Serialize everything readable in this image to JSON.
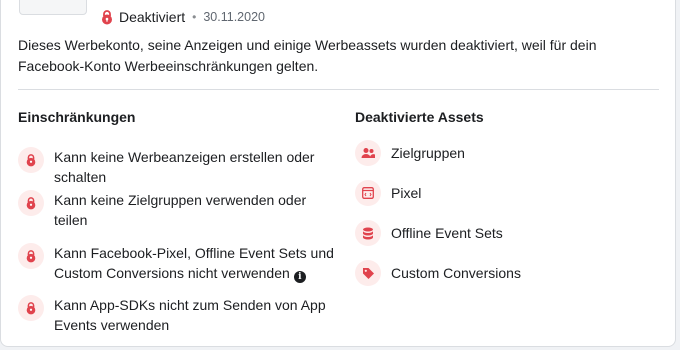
{
  "colors": {
    "accent": "#e0434d",
    "badge_bg": "#fdeceb"
  },
  "status": {
    "label": "Deaktiviert",
    "date": "30.11.2020",
    "icon": "lock-icon"
  },
  "description": "Dieses Werbekonto, seine Anzeigen und einige Werbeassets wurden deaktiviert, weil für dein Facebook-Konto Werbeeinschränkungen gelten.",
  "restrictions": {
    "title": "Einschränkungen",
    "items": [
      {
        "line1": "Kann keine Werbeanzeigen erstellen oder",
        "line2": "schalten",
        "icon": "lock-icon"
      },
      {
        "line1": "Kann keine Zielgruppen verwenden oder",
        "line2": "teilen",
        "icon": "lock-icon"
      },
      {
        "line1": "Kann Facebook-Pixel, Offline Event Sets und",
        "line2": "Custom Conversions nicht verwenden",
        "icon": "lock-icon",
        "info_icon": "info-icon"
      },
      {
        "line1": "Kann App-SDKs nicht zum Senden von App",
        "line2": "Events verwenden",
        "icon": "lock-icon"
      }
    ]
  },
  "assets": {
    "title": "Deaktivierte Assets",
    "items": [
      {
        "label": "Zielgruppen",
        "icon": "people-icon"
      },
      {
        "label": "Pixel",
        "icon": "pixel-icon"
      },
      {
        "label": "Offline Event Sets",
        "icon": "database-icon"
      },
      {
        "label": "Custom Conversions",
        "icon": "tag-icon"
      }
    ]
  }
}
